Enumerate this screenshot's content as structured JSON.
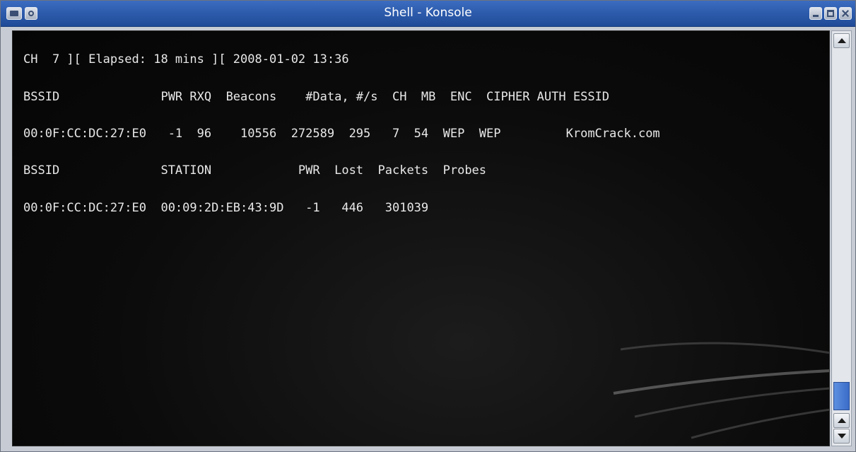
{
  "window": {
    "title": "Shell - Konsole"
  },
  "terminal": {
    "lines": [
      "CH  7 ][ Elapsed: 18 mins ][ 2008-01-02 13:36",
      "BSSID              PWR RXQ  Beacons    #Data, #/s  CH  MB  ENC  CIPHER AUTH ESSID",
      "00:0F:CC:DC:27:E0   -1  96    10556  272589  295   7  54  WEP  WEP         KromCrack.com",
      "BSSID              STATION            PWR  Lost  Packets  Probes",
      "00:0F:CC:DC:27:E0  00:09:2D:EB:43:9D   -1   446   301039"
    ]
  },
  "colors": {
    "titlebar": "#2a58aa",
    "terminal_bg": "#0b0b0b",
    "terminal_text": "#e8e8e8",
    "scroll_thumb": "#4a7bd4"
  },
  "icons": {
    "menu": "window-menu-icon",
    "sticky": "sticky-icon",
    "minimize": "minimize-icon",
    "maximize": "maximize-icon",
    "close": "close-icon"
  }
}
